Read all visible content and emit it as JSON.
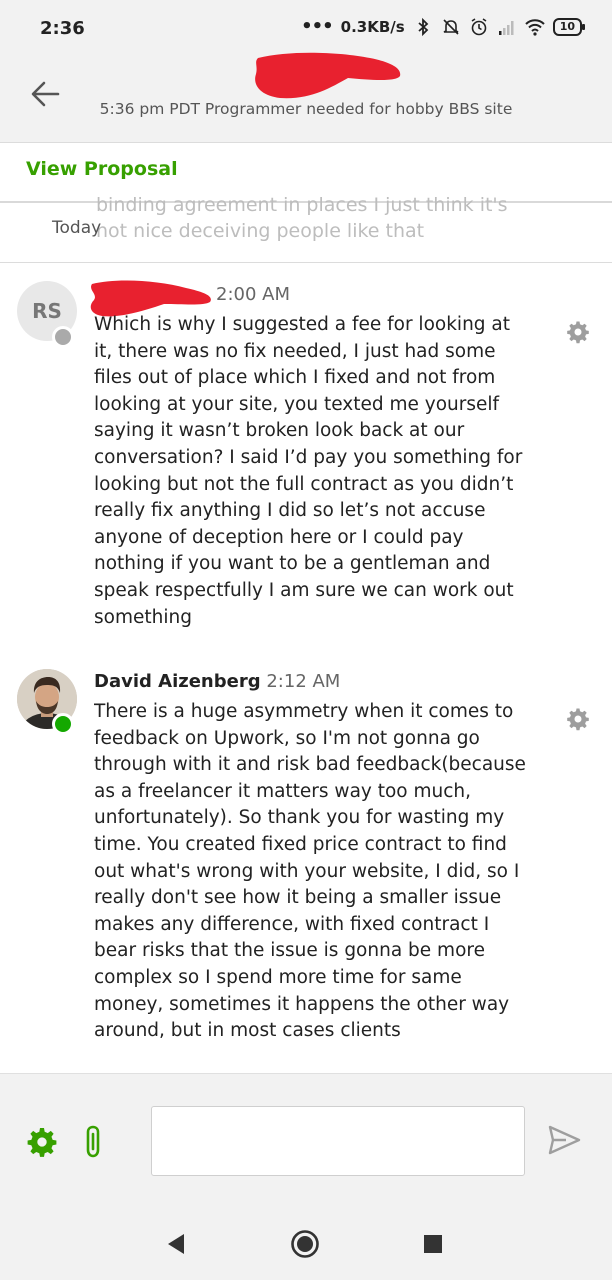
{
  "status_bar": {
    "time": "2:36",
    "network_speed": "0.3KB/s",
    "battery_level": "10",
    "icons": [
      "more-dots-icon",
      "bluetooth-icon",
      "mute-icon",
      "alarm-icon",
      "signal-icon",
      "wifi-icon",
      "battery-icon"
    ]
  },
  "header": {
    "title": "",
    "subtitle": "5:36 pm PDT Programmer needed for hobby BBS site",
    "back_icon": "arrow-left-icon"
  },
  "proposal": {
    "label": "View Proposal"
  },
  "pinned_preview": {
    "line1": "binding agreement in places I just think it's",
    "line2": "not nice deceiving people like that",
    "today_label": "Today"
  },
  "messages": [
    {
      "initials": "RS",
      "sender": "",
      "time": "2:00 AM",
      "body": "Which is why I suggested a fee for looking at it, there was no fix needed, I just had some files out of place which I fixed and not from looking at your site, you texted me yourself saying it wasn’t broken look back at our conversation? I said I’d pay you something for looking but not the full contract as you didn’t really fix anything I did so let’s not accuse anyone of deception here or I could pay nothing if you want to be a gentleman and speak respectfully I am sure we can work out something",
      "online_status": "offline"
    },
    {
      "initials": "",
      "sender": "David Aizenberg",
      "time": "2:12 AM",
      "body": "There is a huge asymmetry when it comes to feedback on Upwork, so I'm not gonna go through with it and risk bad feedback(because as a freelancer it matters way too much, unfortunately). So thank you for wasting my time. You created fixed price contract to find out what's wrong with your website, I did, so I really don't see how it being a smaller issue makes any difference, with fixed contract I bear risks that the issue is gonna be more complex so I spend more time for same money, sometimes it happens the other way around, but in most cases clients",
      "online_status": "online"
    }
  ],
  "composer": {
    "input_value": "",
    "placeholder": ""
  },
  "colors": {
    "accent": "#37a000",
    "online": "#14a800",
    "offline": "#aaaaaa",
    "redaction": "#e8212f",
    "muted_icon": "#9e9e9e"
  }
}
